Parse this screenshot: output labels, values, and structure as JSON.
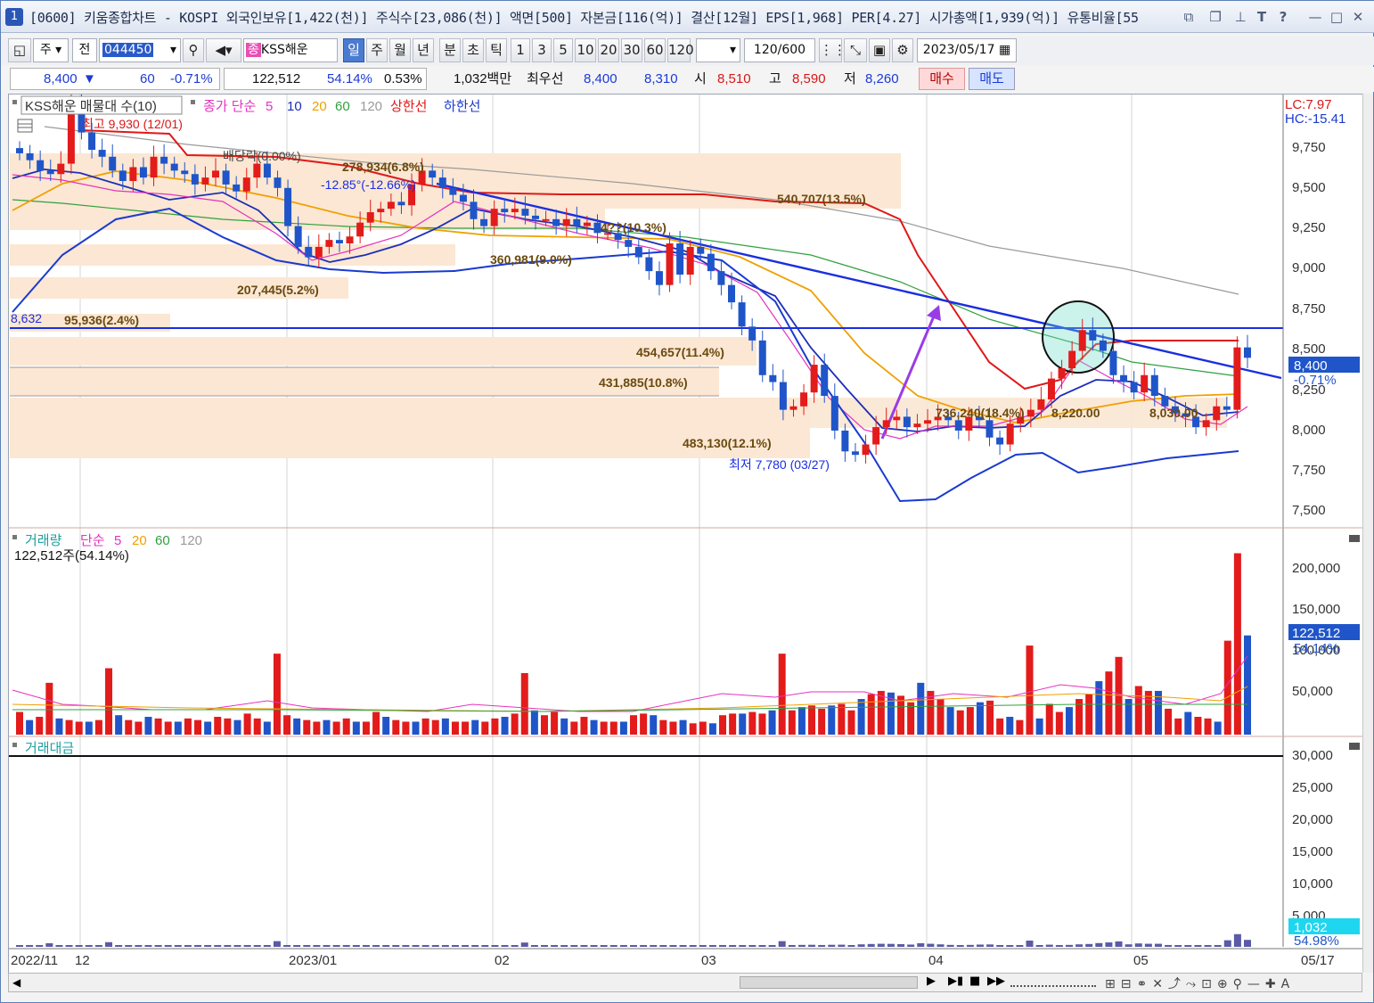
{
  "title_bar": {
    "window_num": "1",
    "text": "[0600] 키움종합차트 - KOSPI 외국인보유[1,422(천)] 주식수[23,086(천)] 액면[500] 자본금[116(억)] 결산[12월] EPS[1,968] PER[4.27] 시가총액[1,939(억)] 유통비율[55",
    "icons": [
      "restore-icon",
      "window-icon",
      "pin-icon",
      "text-icon",
      "help-icon",
      "minimize-icon",
      "maximize-icon",
      "close-icon"
    ]
  },
  "toolbar": {
    "market": "주",
    "all": "전",
    "code": "044450",
    "stock_badge": "종",
    "stock_name": "KSS해운",
    "periods": [
      "일",
      "주",
      "월",
      "년",
      "분",
      "초",
      "틱"
    ],
    "active_period": "일",
    "intervals": [
      "1",
      "3",
      "5",
      "10",
      "20",
      "30",
      "60",
      "120"
    ],
    "count": "120",
    "count_max": "/600",
    "date": "2023/05/17"
  },
  "quote": {
    "price": "8,400",
    "arrow": "▼",
    "change": "60",
    "change_pct": "-0.71%",
    "volume": "122,512",
    "vol_ratio": "54.14%",
    "turnover": "0.53%",
    "amount": "1,032백만",
    "best_ask_label": "최우선",
    "ask": "8,400",
    "bid": "8,310",
    "open_label": "시",
    "open": "8,510",
    "high_label": "고",
    "high": "8,590",
    "low_label": "저",
    "low": "8,260",
    "buy": "매수",
    "sell": "매도"
  },
  "price_panel": {
    "title": "KSS해운 매물대 수(10)",
    "ma_legend": {
      "label": "종가 단순",
      "periods": [
        "5",
        "10",
        "20",
        "60",
        "120"
      ],
      "upper": "상한선",
      "lower": "하한선"
    },
    "lc": "LC:7.97",
    "hc": "HC:-15.41",
    "current_price": "8,400",
    "current_change": "-0.71%",
    "y_ticks": [
      "9,750",
      "9,500",
      "9,250",
      "9,000",
      "8,750",
      "8,500",
      "8,250",
      "8,000",
      "7,750",
      "7,500"
    ],
    "annotations": {
      "high": "최고 9,930 (12/01)",
      "low": "최저 7,780 (03/27)",
      "dividend": "배당락(0.00%)",
      "trend_angle": "-12.85°(-12.66%)",
      "hline_value": "8,632"
    },
    "volume_profile": [
      "95,936(2.4%)",
      "207,445(5.2%)",
      "278,934(6.8%)",
      "360,981(9.0%)",
      "4??(10.3%)",
      "540,707(13.5%)",
      "454,657(11.4%)",
      "431,885(10.8%)",
      "483,130(12.1%)",
      "736,240(18.4%)"
    ],
    "box_labels": [
      "8,220.00",
      "8,030.00"
    ]
  },
  "volume_panel": {
    "title": "거래량",
    "legend": {
      "label": "단순",
      "periods": [
        "5",
        "20",
        "60",
        "120"
      ]
    },
    "current": "122,512주(54.14%)",
    "y_ticks": [
      "200,000",
      "150,000",
      "100,000",
      "50,000"
    ],
    "cur_value": "122,512",
    "cur_pct": "54.14%"
  },
  "amount_panel": {
    "title": "거래대금",
    "y_ticks": [
      "30,000",
      "25,000",
      "20,000",
      "15,000",
      "10,000",
      "5,000"
    ],
    "cur_value": "1,032",
    "cur_pct": "54.98%"
  },
  "x_axis": {
    "labels": [
      "2022/11",
      "12",
      "2023/01",
      "02",
      "03",
      "04",
      "05"
    ],
    "end_label": "05/17"
  },
  "chart_data": {
    "type": "candlestick",
    "x": [
      "2022-12-01",
      "2023-05-17"
    ],
    "ylim": [
      7450,
      9950
    ],
    "high": 9930,
    "low": 7780,
    "last": 8400,
    "hline": 8632,
    "volume_ylim": [
      0,
      240000
    ],
    "last_volume": 122512,
    "colors": {
      "up": "#e31b1b",
      "down": "#1f55c9",
      "ma5": "#e632c0",
      "ma10": "#1d2fb8",
      "ma20": "#f0a000",
      "ma60": "#30a040",
      "ma120": "#9a9a9a",
      "upper": "#e01818",
      "lower": "#1a3ad0",
      "trend": "#1a2ee0",
      "arrow": "#9a3ce6"
    }
  }
}
